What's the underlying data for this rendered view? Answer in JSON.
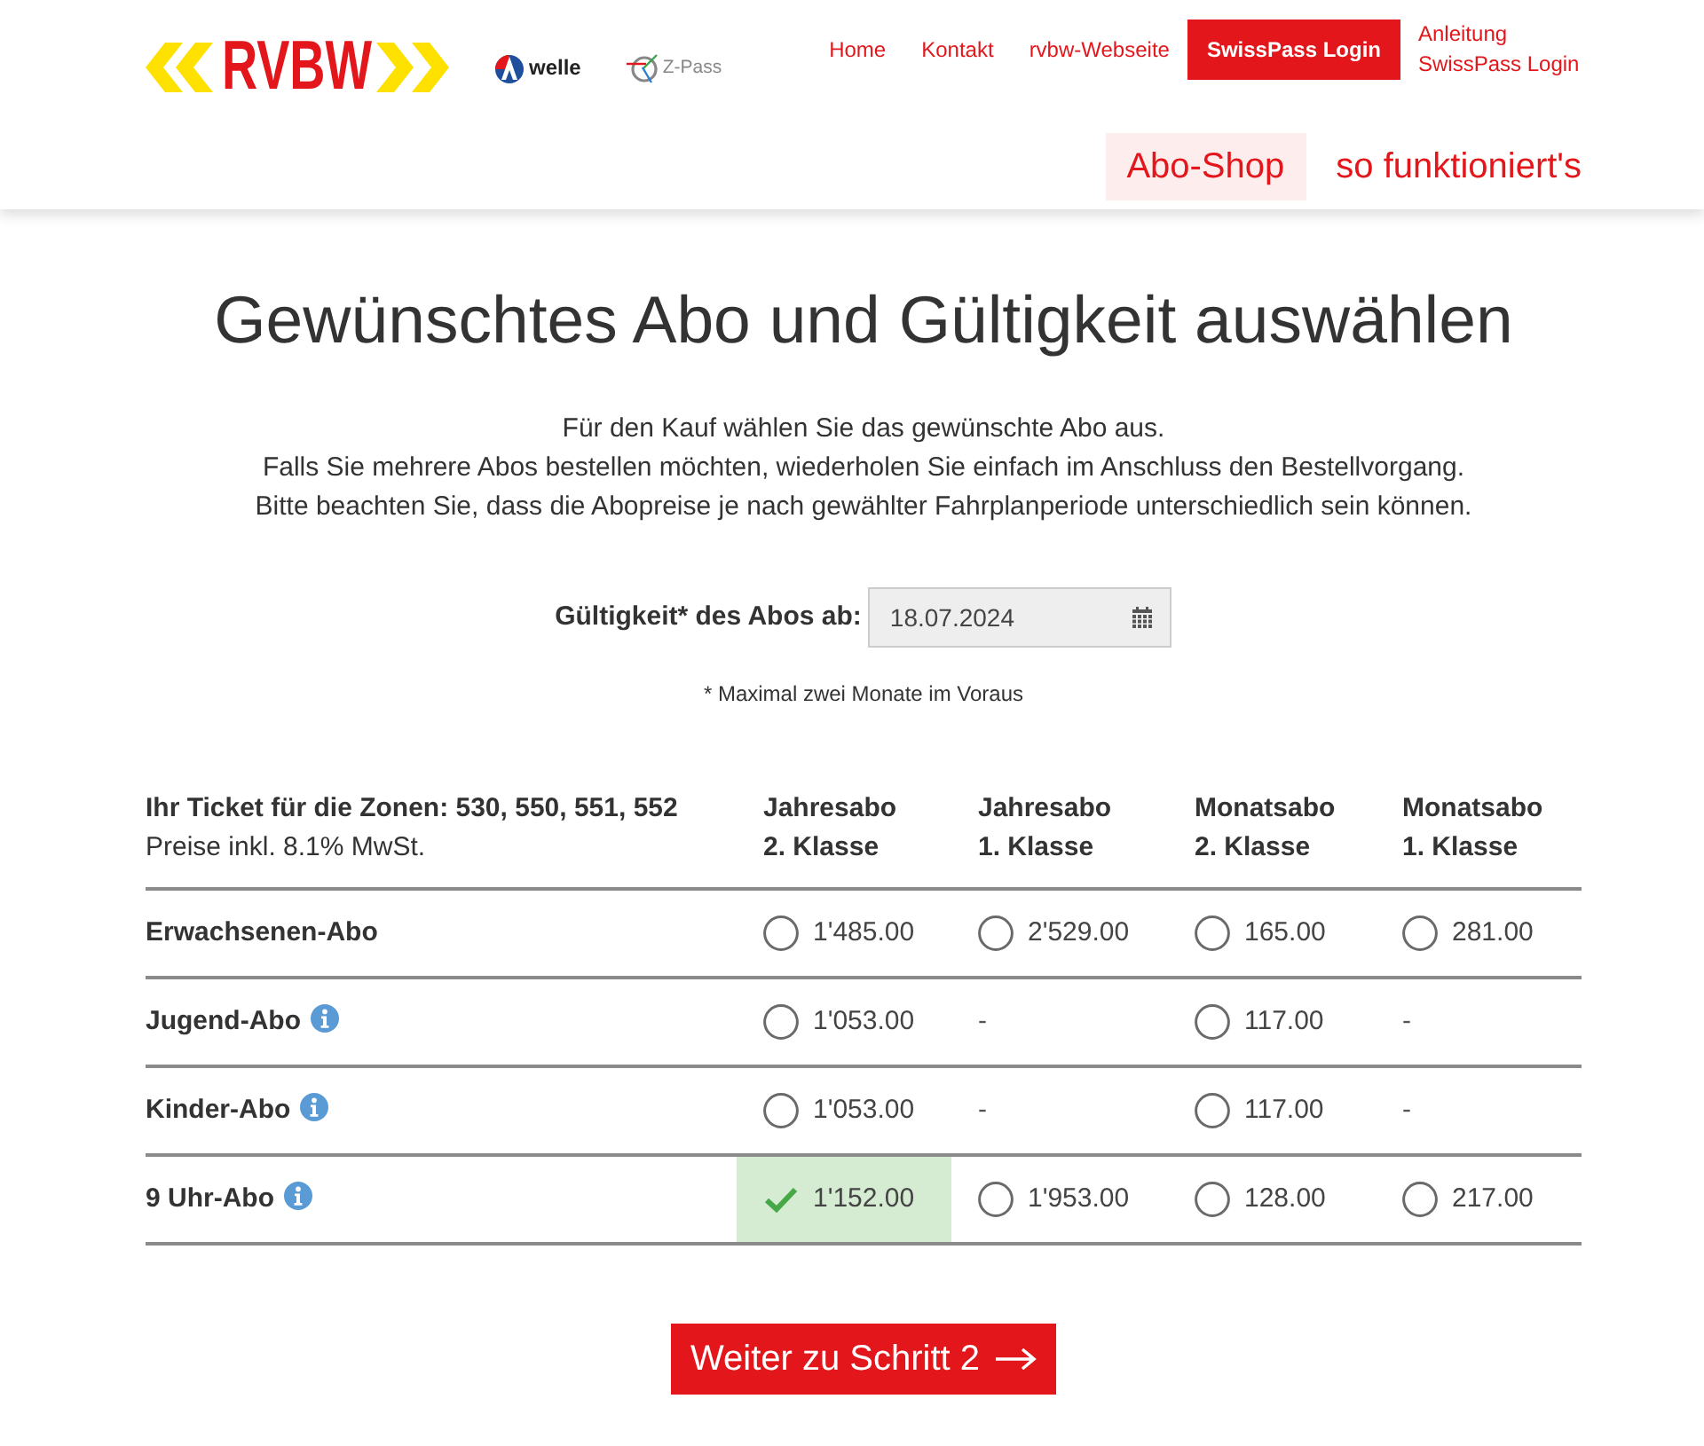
{
  "header": {
    "logo": {
      "text": "RVBW"
    },
    "partner_logos": [
      {
        "text": "welle"
      },
      {
        "text": "Z-Pass"
      }
    ],
    "nav": [
      {
        "label": "Home",
        "kind": "link"
      },
      {
        "label": "Kontakt",
        "kind": "link"
      },
      {
        "label": "rvbw-Webseite",
        "kind": "link"
      },
      {
        "label": "SwissPass Login",
        "kind": "button"
      },
      {
        "label": "Anleitung SwissPass Login",
        "kind": "link"
      }
    ],
    "tabs": [
      {
        "label": "Abo-Shop",
        "selected": true
      },
      {
        "label": "so funktioniert's",
        "selected": false
      }
    ]
  },
  "title": "Gewünschtes Abo und Gültigkeit auswählen",
  "intro": [
    "Für den Kauf wählen Sie das gewünschte Abo aus.",
    "Falls Sie mehrere Abos bestellen möchten, wiederholen Sie einfach im Anschluss den Bestellvorgang.",
    "Bitte beachten Sie, dass die Abopreise je nach gewählter Fahrplanperiode unterschiedlich sein können."
  ],
  "validity": {
    "label": "Gültigkeit* des Abos ab:",
    "value": "18.07.2024",
    "note": "* Maximal zwei Monate im Voraus"
  },
  "table": {
    "zones": "Ihr Ticket für die Zonen: 530, 550, 551, 552",
    "vat_note": "Preise inkl. 8.1% MwSt.",
    "columns": [
      {
        "type": "Jahresabo",
        "class": "2. Klasse"
      },
      {
        "type": "Jahresabo",
        "class": "1. Klasse"
      },
      {
        "type": "Monatsabo",
        "class": "2. Klasse"
      },
      {
        "type": "Monatsabo",
        "class": "1. Klasse"
      }
    ],
    "rows": [
      {
        "label": "Erwachsenen-Abo",
        "info": false,
        "cells": [
          {
            "kind": "option",
            "price": "1'485.00",
            "selected": false
          },
          {
            "kind": "option",
            "price": "2'529.00",
            "selected": false
          },
          {
            "kind": "option",
            "price": "165.00",
            "selected": false
          },
          {
            "kind": "option",
            "price": "281.00",
            "selected": false
          }
        ]
      },
      {
        "label": "Jugend-Abo",
        "info": true,
        "cells": [
          {
            "kind": "option",
            "price": "1'053.00",
            "selected": false
          },
          {
            "kind": "unavailable",
            "text": "-"
          },
          {
            "kind": "option",
            "price": "117.00",
            "selected": false
          },
          {
            "kind": "unavailable",
            "text": "-"
          }
        ]
      },
      {
        "label": "Kinder-Abo",
        "info": true,
        "cells": [
          {
            "kind": "option",
            "price": "1'053.00",
            "selected": false
          },
          {
            "kind": "unavailable",
            "text": "-"
          },
          {
            "kind": "option",
            "price": "117.00",
            "selected": false
          },
          {
            "kind": "unavailable",
            "text": "-"
          }
        ]
      },
      {
        "label": "9 Uhr-Abo",
        "info": true,
        "cells": [
          {
            "kind": "option",
            "price": "1'152.00",
            "selected": true
          },
          {
            "kind": "option",
            "price": "1'953.00",
            "selected": false
          },
          {
            "kind": "option",
            "price": "128.00",
            "selected": false
          },
          {
            "kind": "option",
            "price": "217.00",
            "selected": false
          }
        ]
      }
    ]
  },
  "next_button": {
    "label": "Weiter zu Schritt 2"
  }
}
